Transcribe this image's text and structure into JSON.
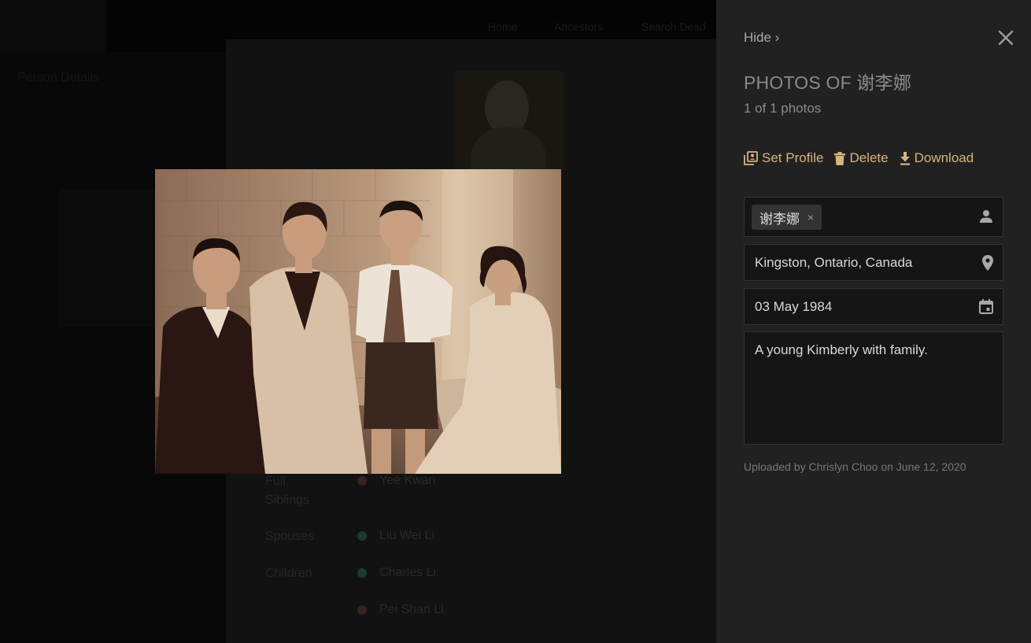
{
  "panel": {
    "hide_label": "Hide ›",
    "title": "PHOTOS OF 谢李娜",
    "count": "1 of 1 photos",
    "actions": {
      "set_profile": "Set Profile",
      "delete": "Delete",
      "download": "Download"
    },
    "tags": [
      {
        "name": "谢李娜",
        "remove": "×"
      }
    ],
    "location": "Kingston, Ontario, Canada",
    "date": "03 May 1984",
    "description": "A young Kimberly with family.",
    "uploaded_by": "Uploaded by Chrislyn Choo on June 12, 2020",
    "accent_color": "#d6b47e"
  },
  "background": {
    "nav": [
      "Home",
      "Ancestors",
      "Search Dead"
    ],
    "left_title": "Person Details",
    "relations": [
      {
        "label": "Full Siblings",
        "value": "Yee Kwan",
        "dot_color": "#3a2222"
      },
      {
        "label": "Spouses",
        "value": "Liu Wei Li",
        "dot_color": "#1e3a2c"
      },
      {
        "label": "Children",
        "value": "Charles Li",
        "dot_color": "#1e3a2c"
      },
      {
        "label": "",
        "value": "Pei Shan Li",
        "dot_color": "#3a2222"
      }
    ]
  },
  "photo": {
    "alt": "Sepia family portrait"
  }
}
